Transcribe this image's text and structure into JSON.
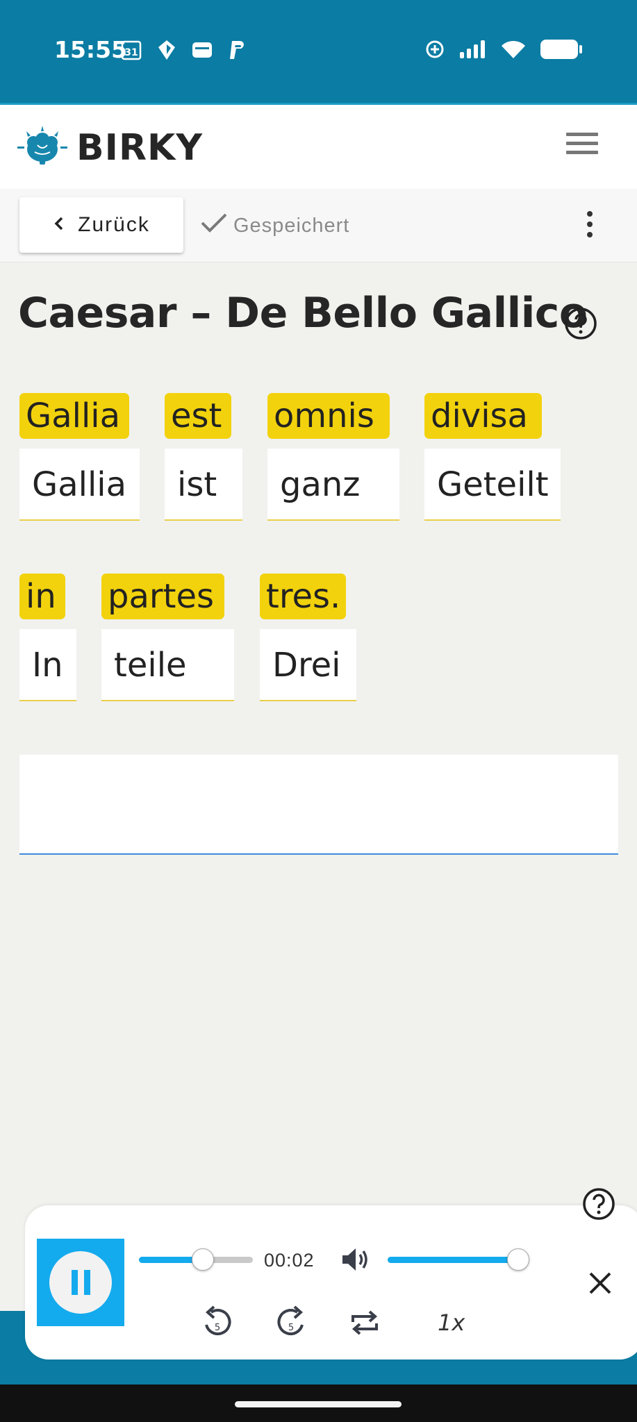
{
  "status_bar": {
    "time": "15:55",
    "calendar_day": "31",
    "left_icons": [
      "calendar-icon",
      "map-pin-icon",
      "wallet-icon",
      "paypal-icon"
    ],
    "right_icons": [
      "data-saver-icon",
      "signal-icon",
      "wifi-icon",
      "battery-icon"
    ]
  },
  "header": {
    "brand": "BIRKY",
    "logo_icon": "brain-icon",
    "menu_icon": "hamburger-menu-icon"
  },
  "toolbar": {
    "back_label": "Zurück",
    "saved_label": "Gespeichert",
    "more_icon": "more-vertical-icon"
  },
  "page": {
    "title": "Caesar – De Bello Gallico"
  },
  "words": [
    {
      "latin": "Gallia",
      "translation": "Gallia"
    },
    {
      "latin": "est",
      "translation": "ist"
    },
    {
      "latin": "omnis",
      "translation": "ganz"
    },
    {
      "latin": "divisa",
      "translation": "Geteilt"
    },
    {
      "latin": "in",
      "translation": "In"
    },
    {
      "latin": "partes",
      "translation": "teile"
    },
    {
      "latin": "tres.",
      "translation": "Drei"
    }
  ],
  "answer": {
    "value": "",
    "placeholder": ""
  },
  "player": {
    "elapsed": "00:02",
    "progress_fraction": 0.56,
    "volume_fraction": 1.0,
    "speed": "1x",
    "rewind_seconds": "5",
    "forward_seconds": "5"
  },
  "colors": {
    "brand_teal": "#0b7ca3",
    "highlight_yellow": "#f2d20c",
    "accent_blue": "#14aaee"
  }
}
